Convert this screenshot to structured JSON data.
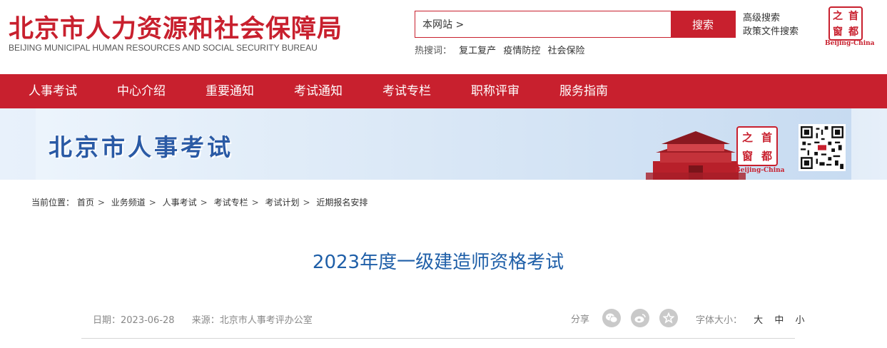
{
  "header": {
    "title": "北京市人力资源和社会保障局",
    "subtitle": "BEIJING MUNICIPAL HUMAN RESOURCES AND SOCIAL SECURITY BUREAU",
    "search_value": "本网站 >",
    "search_button": "搜索",
    "advanced_search": "高级搜索",
    "policy_search": "政策文件搜索",
    "hot_label": "热搜词：",
    "hot_words": [
      "复工复产",
      "疫情防控",
      "社会保险"
    ],
    "logo_chars": [
      "之",
      "首",
      "窗",
      "都"
    ],
    "logo_caption": "Beijing-China"
  },
  "nav": {
    "items": [
      "人事考试",
      "中心介绍",
      "重要通知",
      "考试通知",
      "考试专栏",
      "职称评审",
      "服务指南"
    ]
  },
  "banner": {
    "title": "北京市人事考试",
    "seal_chars": [
      "之",
      "首",
      "窗",
      "都"
    ],
    "seal_caption": "Beijing-China"
  },
  "breadcrumb": {
    "label": "当前位置：",
    "items": [
      "首页",
      "业务频道",
      "人事考试",
      "考试专栏",
      "考试计划",
      "近期报名安排"
    ],
    "separator": ">"
  },
  "article": {
    "title": "2023年度一级建造师资格考试",
    "date": "日期：2023-06-28",
    "source": "来源：北京市人事考评办公室",
    "share_label": "分享",
    "font_size_label": "字体大小：",
    "font_sizes": [
      "大",
      "中",
      "小"
    ]
  },
  "colors": {
    "brand_red": "#c8202e",
    "title_blue": "#1f5fa8",
    "banner_blue": "#2a5aa5"
  },
  "icons": {
    "share": [
      "wechat-icon",
      "weibo-icon",
      "favorite-star-icon"
    ]
  }
}
